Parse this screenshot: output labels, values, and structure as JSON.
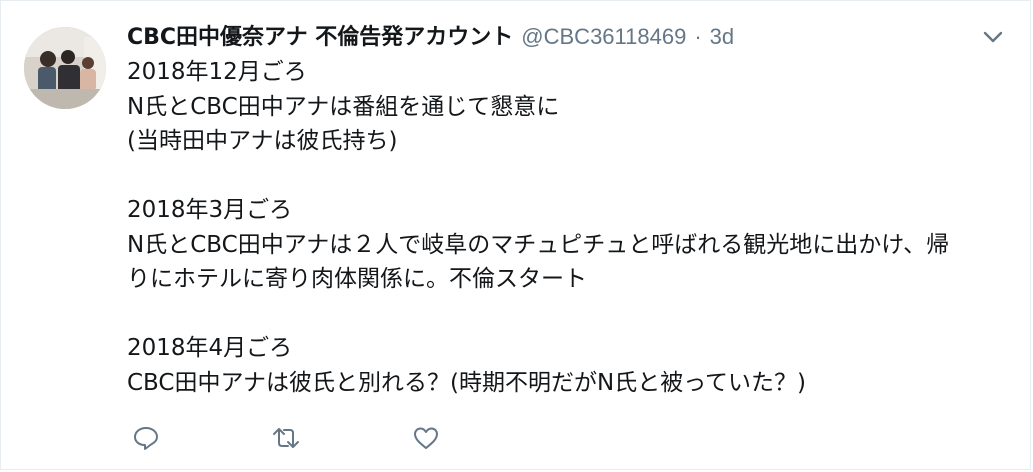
{
  "tweet": {
    "display_name": "CBC田中優奈アナ 不倫告発アカウント",
    "handle": "@CBC36118469",
    "separator": "·",
    "time": "3d",
    "lines": [
      "2018年12月ごろ",
      "N氏とCBC田中アナは番組を通じて懇意に",
      "(当時田中アナは彼氏持ち)",
      "",
      "2018年3月ごろ",
      "N氏とCBC田中アナは２人で岐阜のマチュピチュと呼ばれる観光地に出かけ、帰",
      "りにホテルに寄り肉体関係に。不倫スタート",
      "",
      "2018年4月ごろ",
      "CBC田中アナは彼氏と別れる？(時期不明だがN氏と被っていた？)"
    ]
  },
  "icons": {
    "caret": "chevron-down-icon",
    "reply": "reply-icon",
    "retweet": "retweet-icon",
    "like": "heart-icon"
  },
  "colors": {
    "text": "#14171a",
    "secondary": "#657786",
    "icon": "#657786",
    "border": "#e6ecf0"
  }
}
